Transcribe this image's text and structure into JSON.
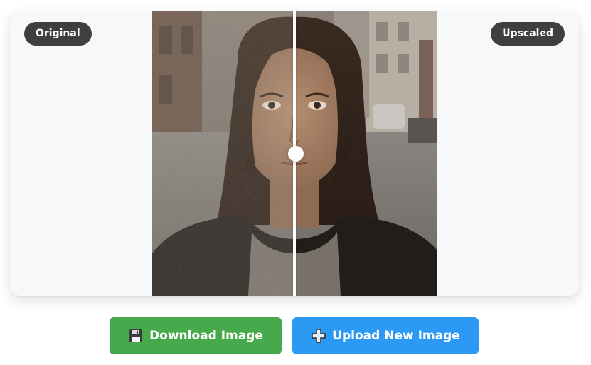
{
  "comparison": {
    "left_label": "Original",
    "right_label": "Upscaled",
    "slider_position_percent": 50
  },
  "actions": {
    "download_label": "Download Image",
    "download_icon": "floppy-disk-icon",
    "upload_label": "Upload New Image",
    "upload_icon": "plus-icon"
  },
  "colors": {
    "download_button": "#46a94b",
    "upload_button": "#2c9af5",
    "badge": "#3f3f42"
  }
}
